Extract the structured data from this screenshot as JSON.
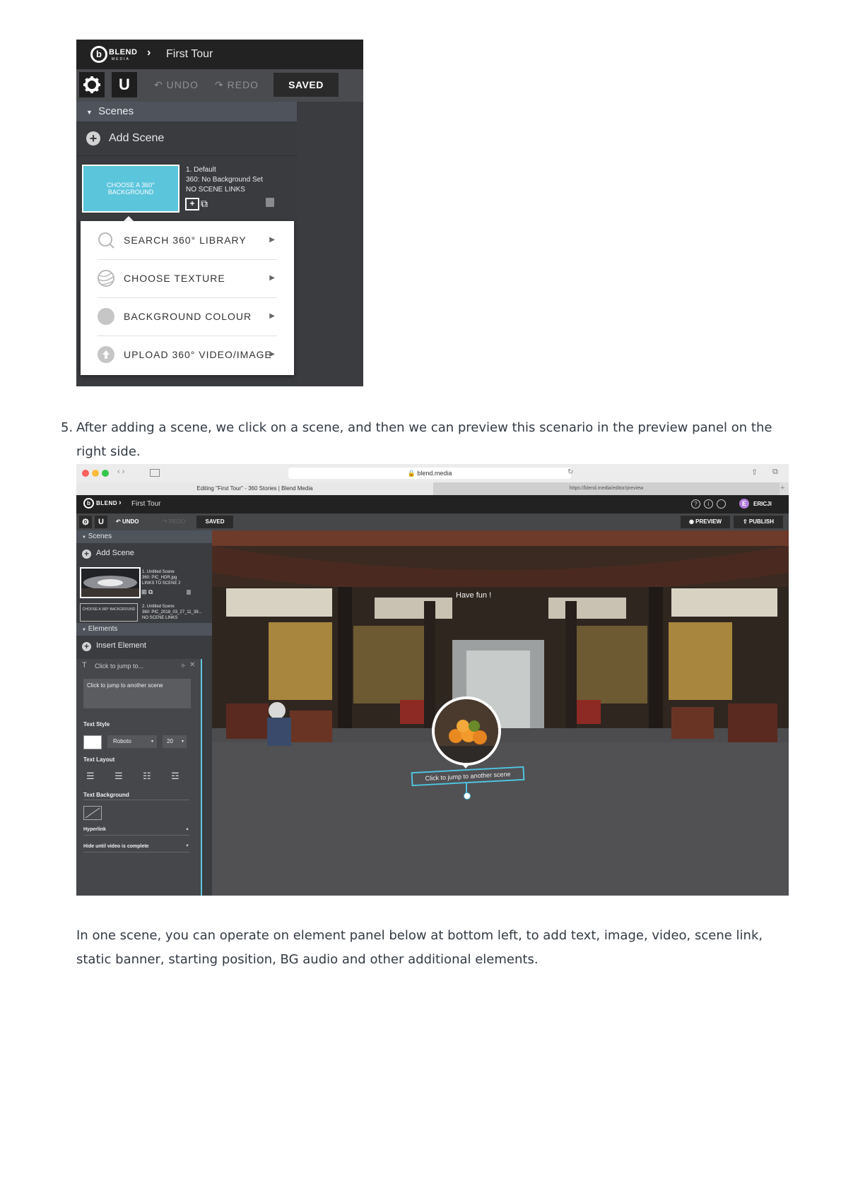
{
  "shot1": {
    "brand": "BLEND",
    "brand_sub": "MEDIA",
    "breadcrumb": "First Tour",
    "undo": "UNDO",
    "redo": "REDO",
    "saved": "SAVED",
    "scenes_header": "Scenes",
    "add_scene": "Add Scene",
    "thumb_text": "CHOOSE A 360° BACKGROUND",
    "scene_title": "1. Default",
    "scene_bg": "360: No Background Set",
    "scene_links": "NO SCENE LINKS",
    "menu": [
      {
        "label": "SEARCH 360° LIBRARY",
        "icon": "search-icon"
      },
      {
        "label": "CHOOSE TEXTURE",
        "icon": "texture-icon"
      },
      {
        "label": "BACKGROUND COLOUR",
        "icon": "colour-circle-icon"
      },
      {
        "label": "UPLOAD 360° VIDEO/IMAGE",
        "icon": "upload-icon"
      }
    ]
  },
  "step5": {
    "number": "5.",
    "text": "After adding a scene, we click on a scene, and then we can preview this scenario in the preview panel on the right side."
  },
  "shot2": {
    "url": "blend.media",
    "tab1": "Editing \"First Tour\" - 360 Stories | Blend Media",
    "tab2": "https://blend.media/editor/preview",
    "brand": "BLEND",
    "breadcrumb": "First Tour",
    "user": "ERICJI",
    "undo": "UNDO",
    "redo": "REDO",
    "saved": "SAVED",
    "preview": "PREVIEW",
    "publish": "PUBLISH",
    "scenes_header": "Scenes",
    "add_scene": "Add Scene",
    "scene1": [
      "1. Untitled Scene",
      "360: PIC_HDR.jpg",
      "LINKS TO SCENE 2"
    ],
    "scene2_thumb": "CHOOSE A 360° BACKGROUND",
    "scene2": [
      "2. Untitled Scene",
      "360: PIC_2018_03_27_11_39...",
      "NO SCENE LINKS"
    ],
    "elements_header": "Elements",
    "insert_element": "Insert Element",
    "element_title": "Click to jump to...",
    "element_text": "Click to jump to another scene",
    "text_style": "Text Style",
    "font": "Roboto",
    "font_size": "20",
    "text_layout": "Text Layout",
    "text_background": "Text Background",
    "hyperlink": "Hyperlink",
    "hide_until": "Hide until video is complete",
    "have_fun": "Have fun !",
    "jump_label": "Click to jump to another scene"
  },
  "final_text": "In one scene, you can operate on element panel below at bottom left, to add text, image, video, scene link, static banner, starting position, BG audio and other additional elements."
}
